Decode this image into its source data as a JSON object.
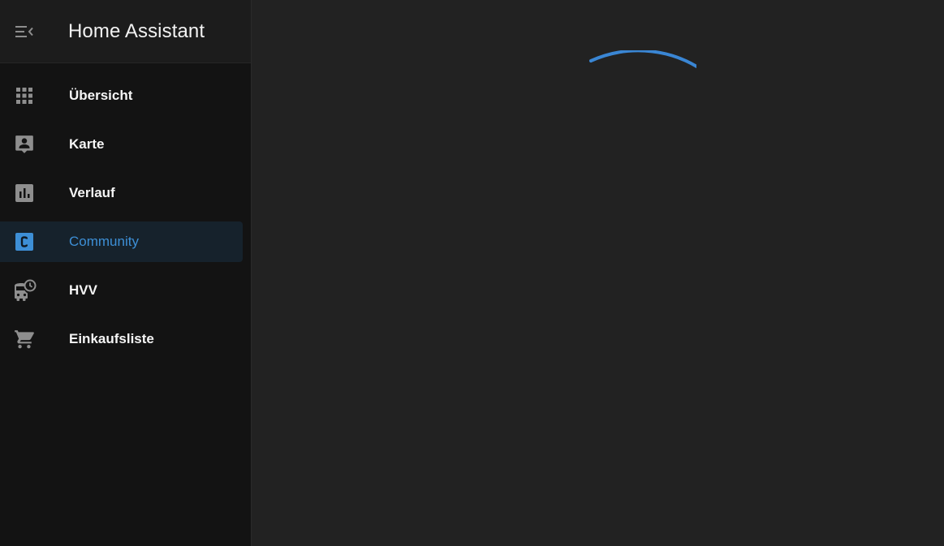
{
  "header": {
    "title": "Home Assistant"
  },
  "colors": {
    "sidebar_bg": "#131313",
    "header_bg": "#1c1c1c",
    "main_bg": "#222222",
    "accent": "#3d8fd6",
    "icon": "#8e8e8e",
    "active_bg": "#16222c"
  },
  "sidebar": {
    "items": [
      {
        "label": "Übersicht",
        "icon": "view-dashboard-grid-icon",
        "active": false
      },
      {
        "label": "Karte",
        "icon": "account-box-map-icon",
        "active": false
      },
      {
        "label": "Verlauf",
        "icon": "chart-box-icon",
        "active": false
      },
      {
        "label": "Community",
        "icon": "alpha-c-box-icon",
        "active": true
      },
      {
        "label": "HVV",
        "icon": "bus-clock-icon",
        "active": false
      },
      {
        "label": "Einkaufsliste",
        "icon": "cart-icon",
        "active": false
      }
    ]
  },
  "main": {
    "loading": true
  }
}
